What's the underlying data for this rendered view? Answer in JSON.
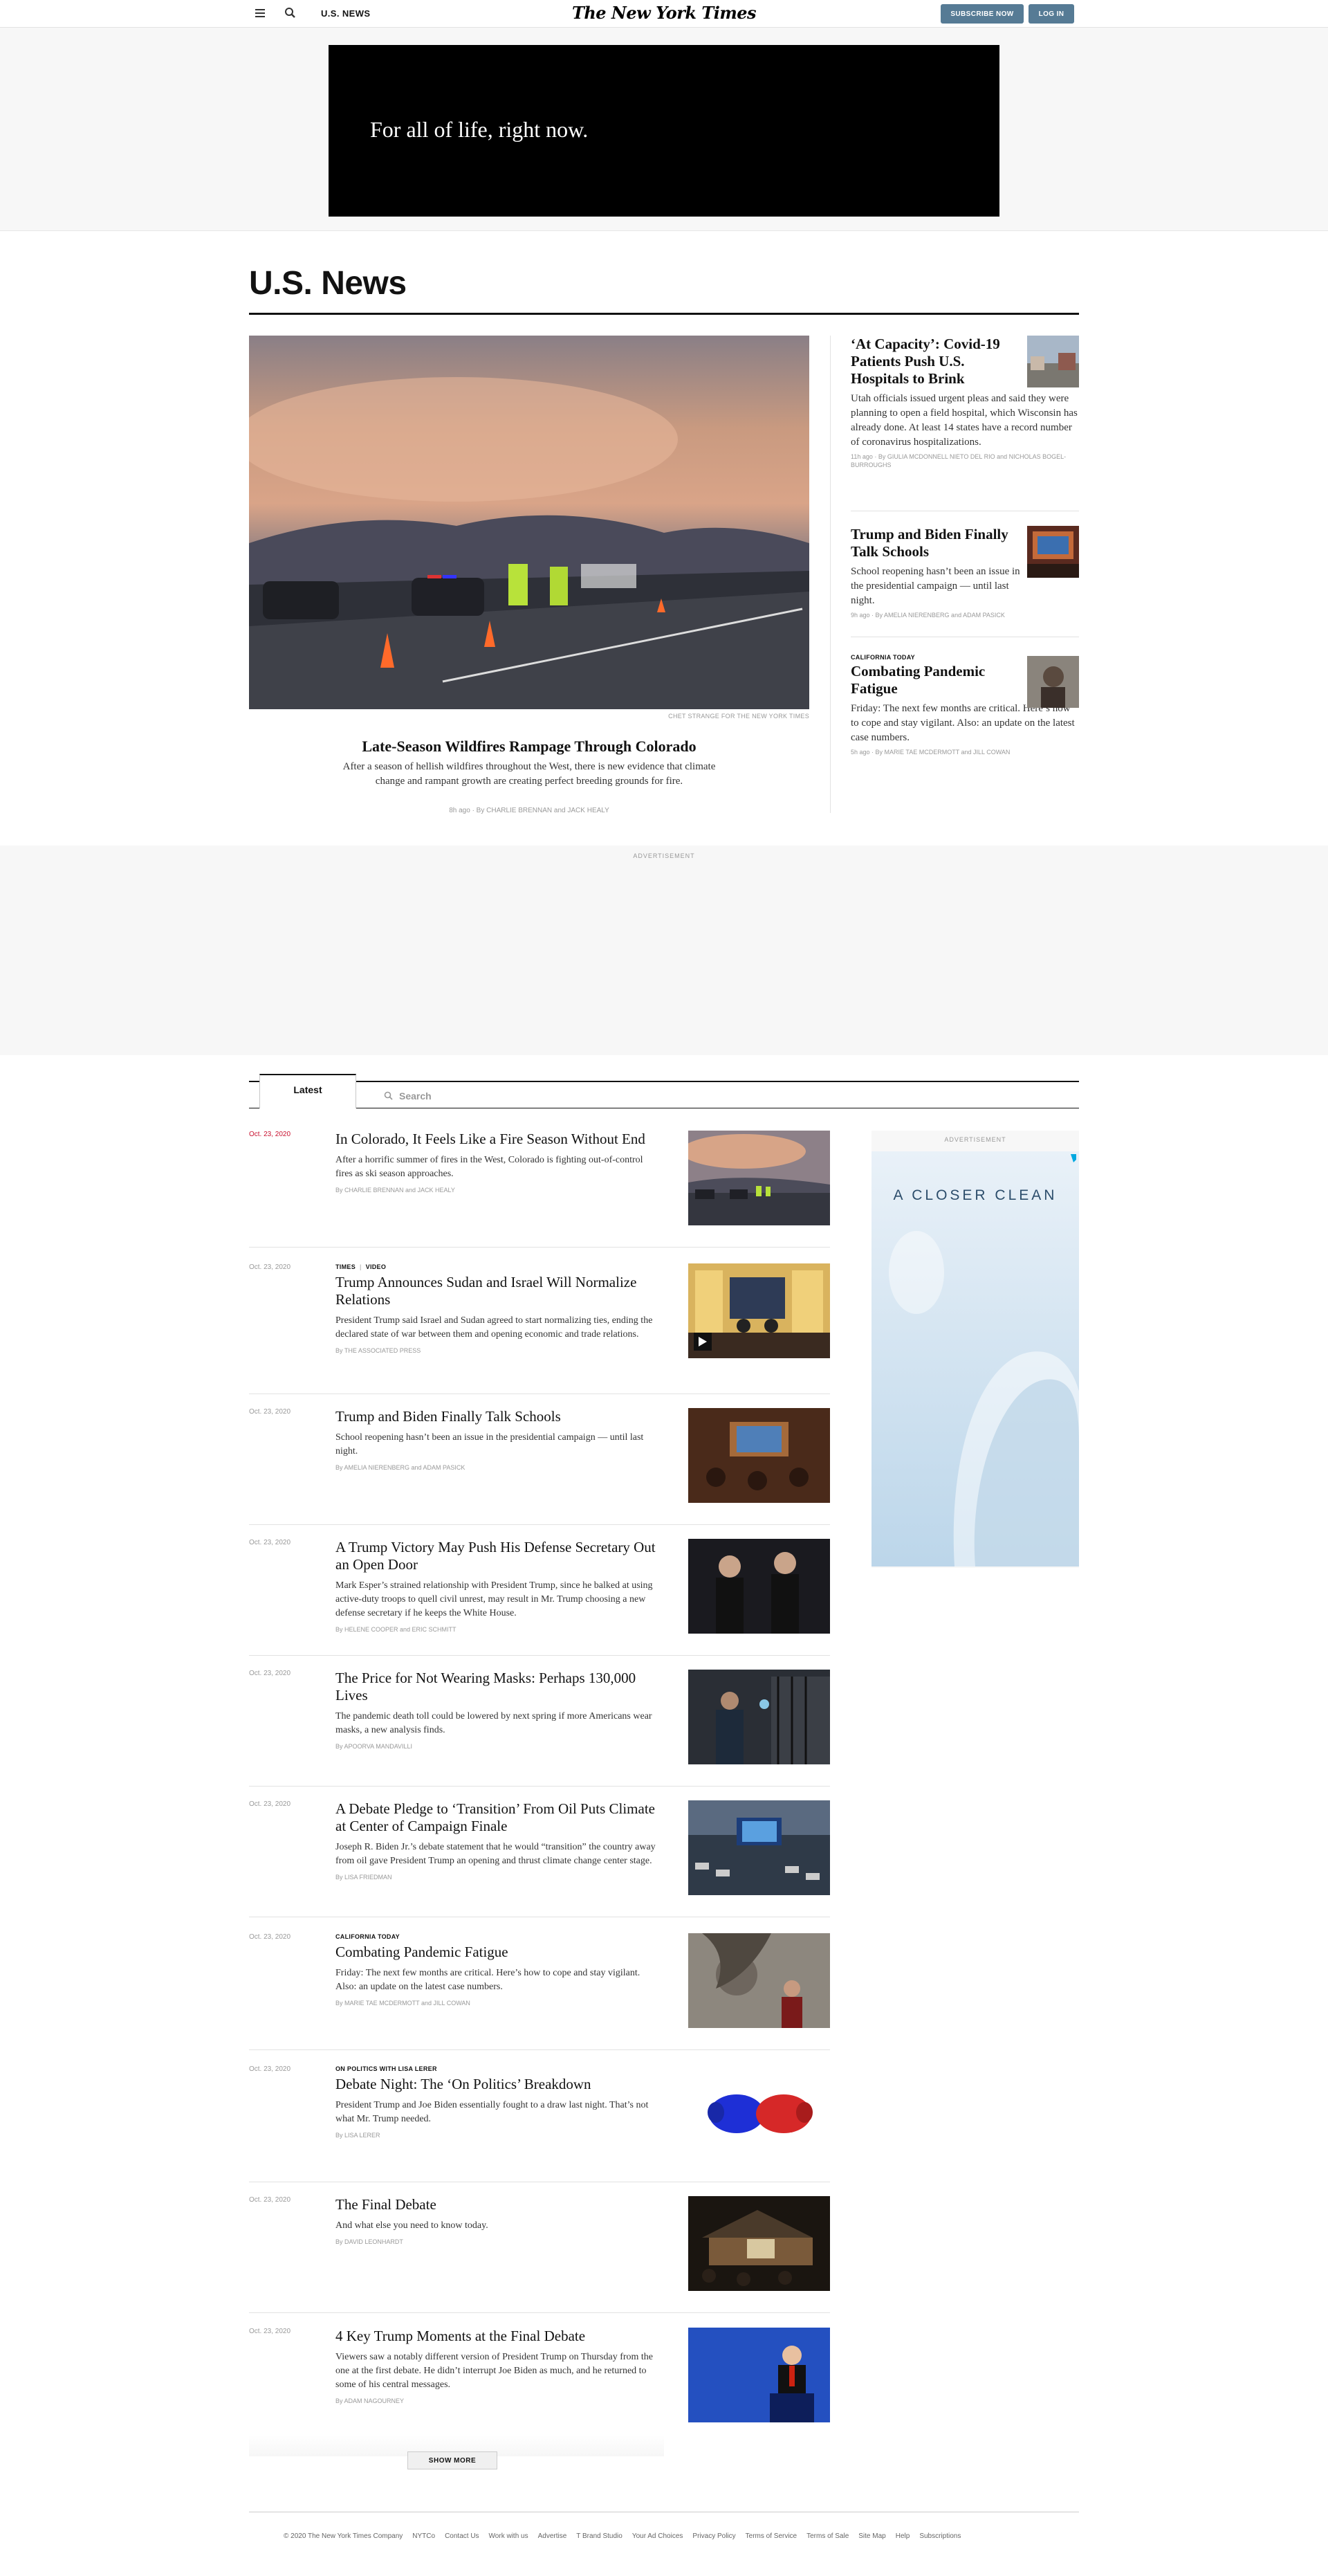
{
  "header": {
    "section_label": "U.S. NEWS",
    "logo": "The New York Times",
    "subscribe_label": "SUBSCRIBE NOW",
    "login_label": "LOG IN"
  },
  "top_ad": {
    "tagline": "For all of life, right now."
  },
  "section": {
    "title": "U.S. News"
  },
  "lead": {
    "photo_credit": "CHET STRANGE FOR THE NEW YORK TIMES",
    "headline": "Late-Season Wildfires Rampage Through Colorado",
    "summary": "After a season of hellish wildfires throughout the West, there is new evidence that climate change and rampant growth are creating perfect breeding grounds for fire.",
    "byline": "8h ago · By CHARLIE BRENNAN and JACK HEALY"
  },
  "side_stories": [
    {
      "kicker": "",
      "headline": "‘At Capacity’: Covid-19 Patients Push U.S. Hospitals to Brink",
      "summary": "Utah officials issued urgent pleas and said they were planning to open a field hospital, which Wisconsin has already done. At least 14 states have a record number of coronavirus hospitalizations.",
      "byline": "11h ago · By GIULIA MCDONNELL NIETO DEL RIO and NICHOLAS BOGEL-BURROUGHS"
    },
    {
      "kicker": "",
      "headline": "Trump and Biden Finally Talk Schools",
      "summary": "School reopening hasn’t been an issue in the presidential campaign — until last night.",
      "byline": "9h ago · By AMELIA NIERENBERG and ADAM PASICK"
    },
    {
      "kicker": "CALIFORNIA TODAY",
      "headline": "Combating Pandemic Fatigue",
      "summary": "Friday: The next few months are critical. Here’s how to cope and stay vigilant. Also: an update on the latest case numbers.",
      "byline": "5h ago · By MARIE TAE MCDERMOTT and JILL COWAN"
    }
  ],
  "ads": {
    "label": "ADVERTISEMENT",
    "side_text": "A CLOSER CLEAN"
  },
  "latest": {
    "tab_label": "Latest",
    "search_placeholder": "Search",
    "items": [
      {
        "date": "Oct. 23, 2020",
        "kicker": "",
        "kicker2": "",
        "headline": "In Colorado, It Feels Like a Fire Season Without End",
        "summary": "After a horrific summer of fires in the West, Colorado is fighting out-of-control fires as ski season approaches.",
        "byline": "By CHARLIE BRENNAN and JACK HEALY"
      },
      {
        "date": "Oct. 23, 2020",
        "kicker": "TIMES",
        "kicker2": "VIDEO",
        "headline": "Trump Announces Sudan and Israel Will Normalize Relations",
        "summary": "President Trump said Israel and Sudan agreed to start normalizing ties, ending the declared state of war between them and opening economic and trade relations.",
        "byline": "By THE ASSOCIATED PRESS"
      },
      {
        "date": "Oct. 23, 2020",
        "kicker": "",
        "kicker2": "",
        "headline": "Trump and Biden Finally Talk Schools",
        "summary": "School reopening hasn’t been an issue in the presidential campaign — until last night.",
        "byline": "By AMELIA NIERENBERG and ADAM PASICK"
      },
      {
        "date": "Oct. 23, 2020",
        "kicker": "",
        "kicker2": "",
        "headline": "A Trump Victory May Push His Defense Secretary Out an Open Door",
        "summary": "Mark Esper’s strained relationship with President Trump, since he balked at using active-duty troops to quell civil unrest, may result in Mr. Trump choosing a new defense secretary if he keeps the White House.",
        "byline": "By HELENE COOPER and ERIC SCHMITT"
      },
      {
        "date": "Oct. 23, 2020",
        "kicker": "",
        "kicker2": "",
        "headline": "The Price for Not Wearing Masks: Perhaps 130,000 Lives",
        "summary": "The pandemic death toll could be lowered by next spring if more Americans wear masks, a new analysis finds.",
        "byline": "By APOORVA MANDAVILLI"
      },
      {
        "date": "Oct. 23, 2020",
        "kicker": "",
        "kicker2": "",
        "headline": "A Debate Pledge to ‘Transition’ From Oil Puts Climate at Center of Campaign Finale",
        "summary": "Joseph R. Biden Jr.’s debate statement that he would “transition” the country away from oil gave President Trump an opening and thrust climate change center stage.",
        "byline": "By LISA FRIEDMAN"
      },
      {
        "date": "Oct. 23, 2020",
        "kicker": "CALIFORNIA TODAY",
        "kicker2": "",
        "headline": "Combating Pandemic Fatigue",
        "summary": "Friday: The next few months are critical. Here’s how to cope and stay vigilant. Also: an update on the latest case numbers.",
        "byline": "By MARIE TAE MCDERMOTT and JILL COWAN"
      },
      {
        "date": "Oct. 23, 2020",
        "kicker": "ON POLITICS WITH LISA LERER",
        "kicker2": "",
        "headline": "Debate Night: The ‘On Politics’ Breakdown",
        "summary": "President Trump and Joe Biden essentially fought to a draw last night. That’s not what Mr. Trump needed.",
        "byline": "By LISA LERER"
      },
      {
        "date": "Oct. 23, 2020",
        "kicker": "",
        "kicker2": "",
        "headline": "The Final Debate",
        "summary": "And what else you need to know today.",
        "byline": "By DAVID LEONHARDT"
      },
      {
        "date": "Oct. 23, 2020",
        "kicker": "",
        "kicker2": "",
        "headline": "4 Key Trump Moments at the Final Debate",
        "summary": "Viewers saw a notably different version of President Trump on Thursday from the one at the first debate. He didn’t interrupt Joe Biden as much, and he returned to some of his central messages.",
        "byline": "By ADAM NAGOURNEY"
      }
    ],
    "show_more_label": "SHOW MORE"
  },
  "footer": {
    "copyright": "© 2020 The New York Times Company",
    "links": [
      "NYTCo",
      "Contact Us",
      "Work with us",
      "Advertise",
      "T Brand Studio",
      "Your Ad Choices",
      "Privacy Policy",
      "Terms of Service",
      "Terms of Sale",
      "Site Map",
      "Help",
      "Subscriptions"
    ]
  }
}
